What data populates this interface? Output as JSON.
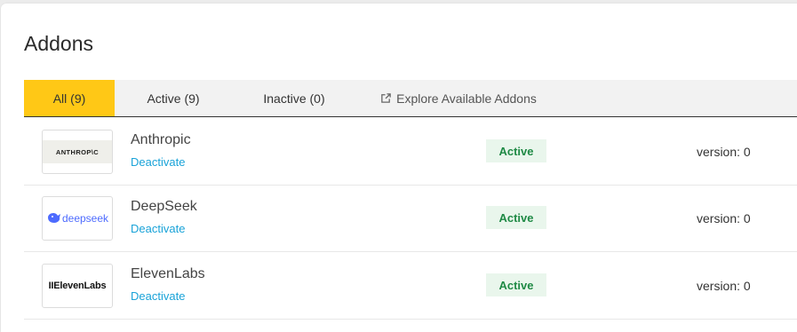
{
  "page": {
    "title": "Addons"
  },
  "tabs": [
    {
      "label": "All (9)"
    },
    {
      "label": "Active (9)"
    },
    {
      "label": "Inactive (0)"
    },
    {
      "label": "Explore Available Addons"
    }
  ],
  "colors": {
    "active_tab": "#ffc816",
    "link": "#1aa3d8",
    "badge_text": "#1f8a45",
    "badge_bg": "#e9f6ec"
  },
  "addons": [
    {
      "name": "Anthropic",
      "action": "Deactivate",
      "status": "Active",
      "version": "version: 0",
      "logo_text": "ANTHROP\\C"
    },
    {
      "name": "DeepSeek",
      "action": "Deactivate",
      "status": "Active",
      "version": "version: 0",
      "logo_text": "deepseek"
    },
    {
      "name": "ElevenLabs",
      "action": "Deactivate",
      "status": "Active",
      "version": "version: 0",
      "logo_text": "IIElevenLabs"
    }
  ]
}
